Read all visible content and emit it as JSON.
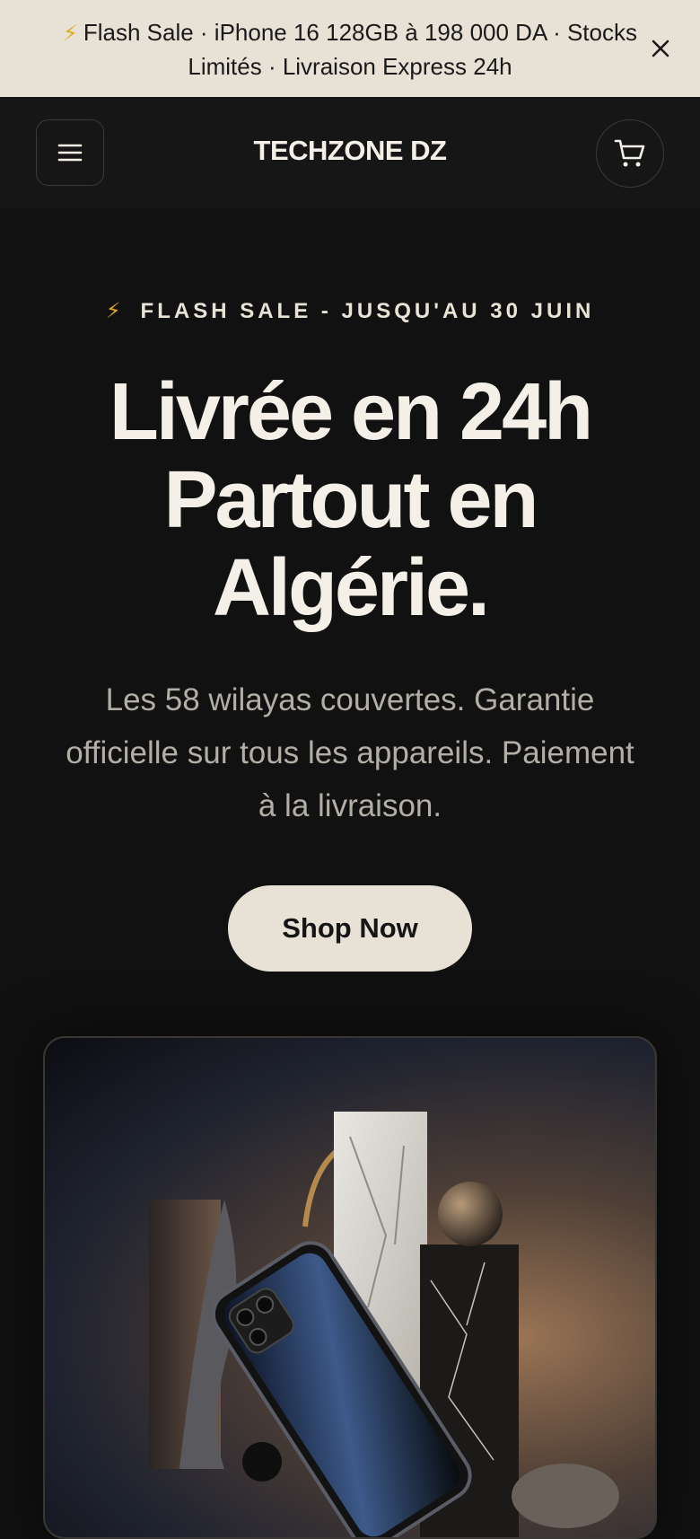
{
  "announcement": {
    "bolt_icon": "⚡",
    "text": "Flash Sale · iPhone 16 128GB à 198 000 DA · Stocks Limités · Livraison Express 24h",
    "close_icon": "close-icon"
  },
  "header": {
    "menu_icon": "hamburger-menu-icon",
    "logo": "TECHZONE DZ",
    "cart_icon": "shopping-cart-icon"
  },
  "hero": {
    "eyebrow_icon": "⚡",
    "eyebrow": "FLASH SALE - JUSQU'AU 30 JUIN",
    "headline": "Livrée en 24h Partout en Algérie.",
    "subtext": "Les 58 wilayas couvertes. Garantie officielle sur tous les appareils. Paiement à la livraison.",
    "cta_label": "Shop Now"
  },
  "product_image": {
    "alt": "iPhone displayed among marble and stone sculptures"
  },
  "colors": {
    "background": "#111111",
    "announcement_bg": "#e8e2d6",
    "accent_cream": "#e8e2d6",
    "bolt": "#e0a91c",
    "text_light": "#f4f0e8",
    "text_muted": "#b3aea6"
  }
}
